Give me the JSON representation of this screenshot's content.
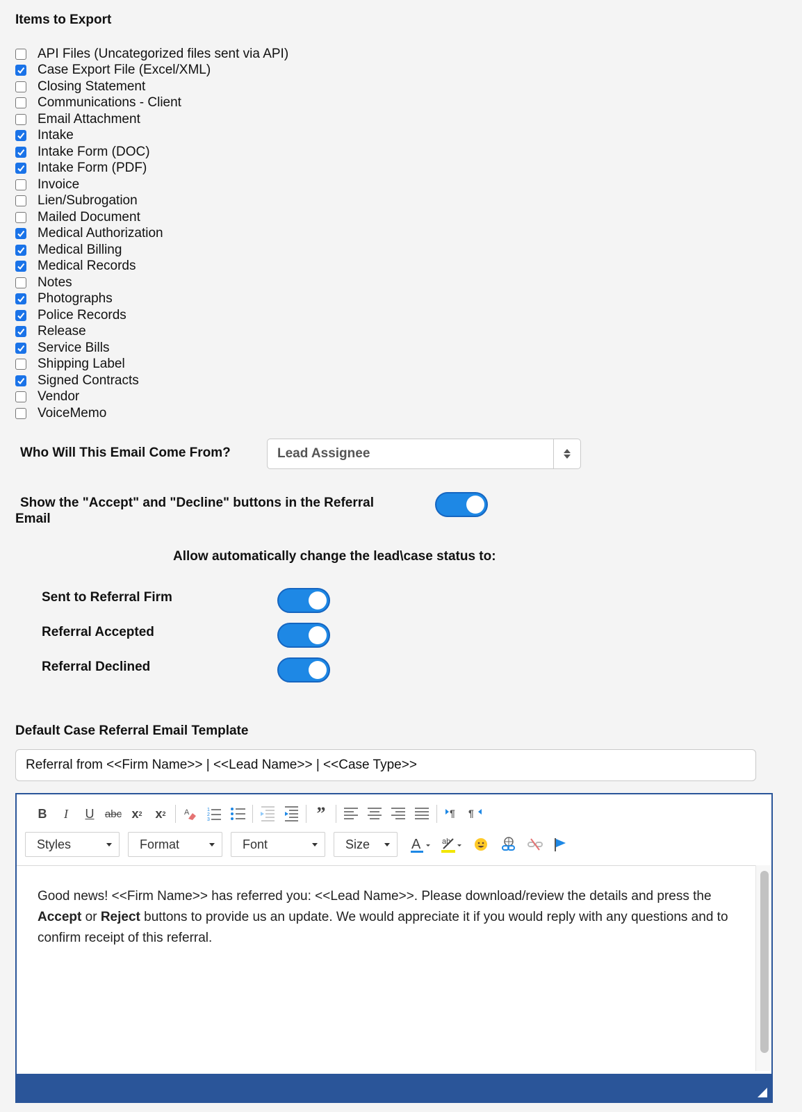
{
  "export": {
    "title": "Items to Export",
    "items": [
      {
        "label": "API Files (Uncategorized files sent via API)",
        "checked": false
      },
      {
        "label": "Case Export File (Excel/XML)",
        "checked": true
      },
      {
        "label": "Closing Statement",
        "checked": false
      },
      {
        "label": "Communications - Client",
        "checked": false
      },
      {
        "label": "Email Attachment",
        "checked": false
      },
      {
        "label": "Intake",
        "checked": true
      },
      {
        "label": "Intake Form (DOC)",
        "checked": true
      },
      {
        "label": "Intake Form (PDF)",
        "checked": true
      },
      {
        "label": "Invoice",
        "checked": false
      },
      {
        "label": "Lien/Subrogation",
        "checked": false
      },
      {
        "label": "Mailed Document",
        "checked": false
      },
      {
        "label": "Medical Authorization",
        "checked": true
      },
      {
        "label": "Medical Billing",
        "checked": true
      },
      {
        "label": "Medical Records",
        "checked": true
      },
      {
        "label": "Notes",
        "checked": false
      },
      {
        "label": "Photographs",
        "checked": true
      },
      {
        "label": "Police Records",
        "checked": true
      },
      {
        "label": "Release",
        "checked": true
      },
      {
        "label": "Service Bills",
        "checked": true
      },
      {
        "label": "Shipping Label",
        "checked": false
      },
      {
        "label": "Signed Contracts",
        "checked": true
      },
      {
        "label": "Vendor",
        "checked": false
      },
      {
        "label": "VoiceMemo",
        "checked": false
      }
    ]
  },
  "from": {
    "label": "Who Will This Email Come From?",
    "value": "Lead Assignee"
  },
  "accept_decline": {
    "label_line1": "Show the \"Accept\" and \"Decline\" buttons in the Referral",
    "label_line2": "Email",
    "on": true
  },
  "status_change": {
    "heading": "Allow automatically change the lead\\case status to:",
    "toggles": [
      {
        "label": "Sent to Referral Firm",
        "on": true
      },
      {
        "label": "Referral Accepted",
        "on": true
      },
      {
        "label": "Referral Declined",
        "on": true
      }
    ]
  },
  "template": {
    "title": "Default Case Referral Email Template",
    "subject": "Referral from <<Firm Name>> | <<Lead Name>> | <<Case Type>>",
    "toolbar": {
      "styles": "Styles",
      "format": "Format",
      "font": "Font",
      "size": "Size"
    },
    "body": {
      "part1": "Good news! <<Firm Name>> has referred you: <<Lead Name>>. Please download/review the details and press the ",
      "accept": "Accept",
      "or": " or ",
      "reject": "Reject",
      "part2": " buttons to provide us an update. We would appreciate it if you would reply with any questions and to confirm receipt of this referral."
    }
  },
  "colors": {
    "accent": "#1e88e5",
    "editor_border": "#2a5599"
  }
}
